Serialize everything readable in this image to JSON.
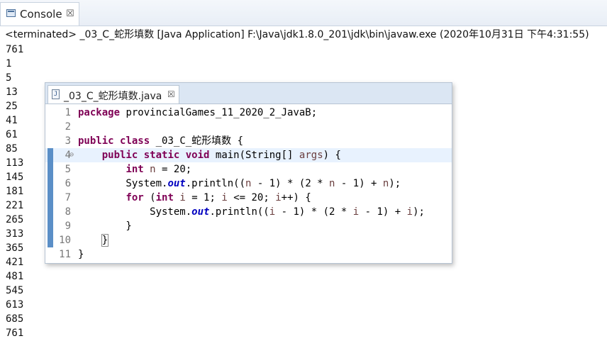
{
  "console": {
    "tab_label": "Console",
    "close_symbol": "☒",
    "status": "<terminated> _03_C_蛇形填数 [Java Application] F:\\Java\\jdk1.8.0_201\\jdk\\bin\\javaw.exe (2020年10月31日 下午4:31:55)",
    "output_lines": [
      "761",
      "1",
      "5",
      "13",
      "25",
      "41",
      "61",
      "85",
      "113",
      "145",
      "181",
      "221",
      "265",
      "313",
      "365",
      "421",
      "481",
      "545",
      "613",
      "685",
      "761"
    ]
  },
  "editor": {
    "tab_label": "_03_C_蛇形填数.java",
    "close_symbol": "☒",
    "file_icon_letter": "J",
    "fold_symbol": "⊖",
    "lines": [
      {
        "num": "1",
        "highlight": false,
        "marker": false,
        "tokens": [
          {
            "t": "package",
            "c": "kw"
          },
          {
            "t": " provincialGames_11_2020_2_JavaB;",
            "c": "pl"
          }
        ]
      },
      {
        "num": "2",
        "highlight": false,
        "marker": false,
        "tokens": []
      },
      {
        "num": "3",
        "highlight": false,
        "marker": false,
        "tokens": [
          {
            "t": "public",
            "c": "kw"
          },
          {
            "t": " ",
            "c": "pl"
          },
          {
            "t": "class",
            "c": "kw"
          },
          {
            "t": " _03_C_蛇形填数 {",
            "c": "pl"
          }
        ]
      },
      {
        "num": "4",
        "highlight": true,
        "marker": true,
        "fold": true,
        "tokens": [
          {
            "t": "    ",
            "c": "pl"
          },
          {
            "t": "public",
            "c": "kw"
          },
          {
            "t": " ",
            "c": "pl"
          },
          {
            "t": "static",
            "c": "kw"
          },
          {
            "t": " ",
            "c": "pl"
          },
          {
            "t": "void",
            "c": "kw"
          },
          {
            "t": " main(String[] ",
            "c": "pl"
          },
          {
            "t": "args",
            "c": "var"
          },
          {
            "t": ") {",
            "c": "pl"
          }
        ]
      },
      {
        "num": "5",
        "highlight": false,
        "marker": true,
        "tokens": [
          {
            "t": "        ",
            "c": "pl"
          },
          {
            "t": "int",
            "c": "kw"
          },
          {
            "t": " ",
            "c": "pl"
          },
          {
            "t": "n",
            "c": "var"
          },
          {
            "t": " = 20;",
            "c": "pl"
          }
        ]
      },
      {
        "num": "6",
        "highlight": false,
        "marker": true,
        "tokens": [
          {
            "t": "        System.",
            "c": "pl"
          },
          {
            "t": "out",
            "c": "fld"
          },
          {
            "t": ".println((",
            "c": "pl"
          },
          {
            "t": "n",
            "c": "var"
          },
          {
            "t": " - 1) * (2 * ",
            "c": "pl"
          },
          {
            "t": "n",
            "c": "var"
          },
          {
            "t": " - 1) + ",
            "c": "pl"
          },
          {
            "t": "n",
            "c": "var"
          },
          {
            "t": ");",
            "c": "pl"
          }
        ]
      },
      {
        "num": "7",
        "highlight": false,
        "marker": true,
        "tokens": [
          {
            "t": "        ",
            "c": "pl"
          },
          {
            "t": "for",
            "c": "kw"
          },
          {
            "t": " (",
            "c": "pl"
          },
          {
            "t": "int",
            "c": "kw"
          },
          {
            "t": " ",
            "c": "pl"
          },
          {
            "t": "i",
            "c": "var"
          },
          {
            "t": " = 1; ",
            "c": "pl"
          },
          {
            "t": "i",
            "c": "var"
          },
          {
            "t": " <= 20; ",
            "c": "pl"
          },
          {
            "t": "i",
            "c": "var"
          },
          {
            "t": "++) {",
            "c": "pl"
          }
        ]
      },
      {
        "num": "8",
        "highlight": false,
        "marker": true,
        "tokens": [
          {
            "t": "            System.",
            "c": "pl"
          },
          {
            "t": "out",
            "c": "fld"
          },
          {
            "t": ".println((",
            "c": "pl"
          },
          {
            "t": "i",
            "c": "var"
          },
          {
            "t": " - 1) * (2 * ",
            "c": "pl"
          },
          {
            "t": "i",
            "c": "var"
          },
          {
            "t": " - 1) + ",
            "c": "pl"
          },
          {
            "t": "i",
            "c": "var"
          },
          {
            "t": ");",
            "c": "pl"
          }
        ]
      },
      {
        "num": "9",
        "highlight": false,
        "marker": true,
        "tokens": [
          {
            "t": "        }",
            "c": "pl"
          }
        ]
      },
      {
        "num": "10",
        "highlight": false,
        "marker": true,
        "tokens": [
          {
            "t": "    ",
            "c": "pl"
          },
          {
            "t": "}",
            "c": "pl",
            "box": true
          }
        ]
      },
      {
        "num": "11",
        "highlight": false,
        "marker": false,
        "tokens": [
          {
            "t": "}",
            "c": "pl"
          }
        ]
      }
    ]
  }
}
